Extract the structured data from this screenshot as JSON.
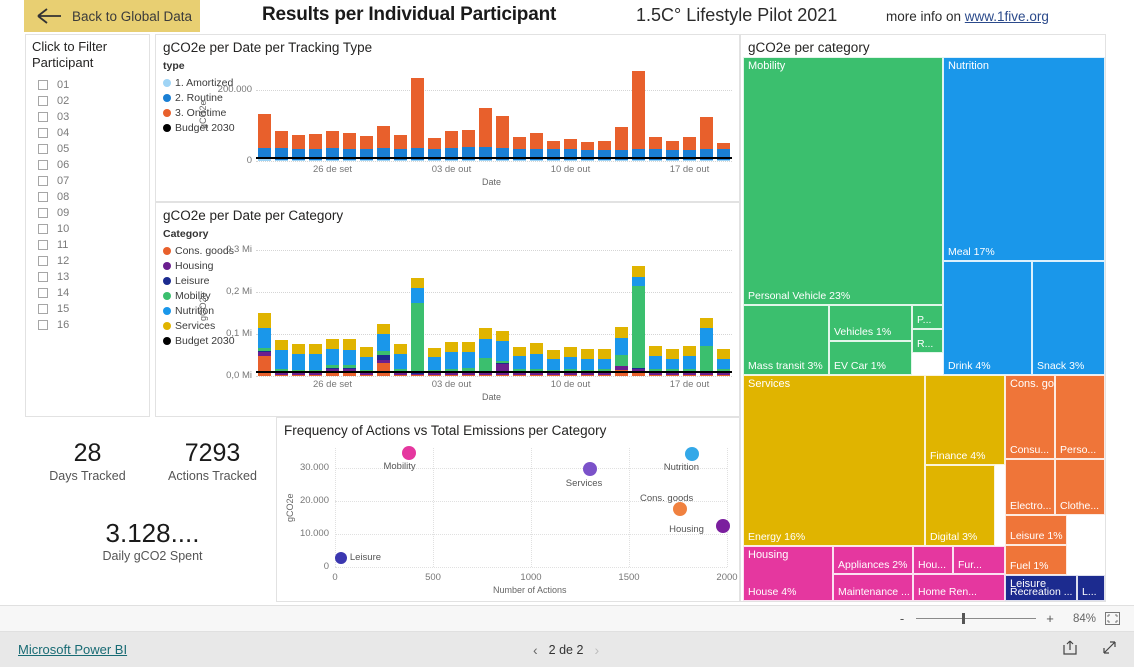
{
  "header": {
    "back_label": "Back to Global Data",
    "back_icon": "arrow-left-icon",
    "title": "Results per Individual Participant",
    "subtitle": "1.5C° Lifestyle Pilot 2021",
    "more_info_prefix": "more info on ",
    "more_info_link": "www.1five.org"
  },
  "slicer": {
    "heading": "Click to Filter Participant",
    "items": [
      "01",
      "02",
      "03",
      "04",
      "05",
      "06",
      "07",
      "08",
      "09",
      "10",
      "11",
      "12",
      "13",
      "14",
      "15",
      "16"
    ]
  },
  "kpis": [
    {
      "value": "28",
      "label": "Days Tracked"
    },
    {
      "value": "7293",
      "label": "Actions Tracked"
    },
    {
      "value": "3.128....",
      "label": "Daily gCO2 Spent"
    }
  ],
  "colors": {
    "amortized": "#9fd4f5",
    "routine": "#1a7fd4",
    "onetime": "#e8602c",
    "budget": "#000000",
    "cons_goods": "#e8602c",
    "housing": "#6b1f8f",
    "leisure": "#1c2b8f",
    "mobility": "#3bbf6e",
    "nutrition": "#1a97ea",
    "services": "#e0b400",
    "housing_tile": "#e5379f",
    "back_bg": "#e8cf72",
    "link": "#186b74"
  },
  "chart_data": [
    {
      "type": "bar",
      "title": "gCO2e per Date per Tracking Type",
      "legend_title": "type",
      "legend": [
        "1. Amortized",
        "2. Routine",
        "3. Onetime",
        "Budget 2030"
      ],
      "xlabel": "Date",
      "ylabel": "gCO2e",
      "ylim": [
        0,
        260000
      ],
      "yticks": [
        "0",
        "200.000"
      ],
      "xticks": [
        "26 de set",
        "03 de out",
        "10 de out",
        "17 de out"
      ],
      "categories": [
        "22 de set",
        "23 de set",
        "24 de set",
        "25 de set",
        "26 de set",
        "27 de set",
        "28 de set",
        "29 de set",
        "30 de set",
        "01 de out",
        "02 de out",
        "03 de out",
        "04 de out",
        "05 de out",
        "06 de out",
        "07 de out",
        "08 de out",
        "09 de out",
        "10 de out",
        "11 de out",
        "12 de out",
        "13 de out",
        "14 de out",
        "15 de out",
        "16 de out",
        "17 de out",
        "18 de out",
        "19 de out"
      ],
      "series": [
        {
          "name": "1. Amortized",
          "values": [
            5000,
            4200,
            4200,
            4200,
            4200,
            4200,
            4200,
            4200,
            4200,
            4200,
            4200,
            4200,
            4200,
            4200,
            4200,
            4200,
            4200,
            4200,
            4200,
            4200,
            4200,
            4200,
            4200,
            4200,
            4200,
            4200,
            4200,
            4200
          ]
        },
        {
          "name": "2. Routine",
          "values": [
            33000,
            32000,
            30000,
            31000,
            32000,
            31000,
            31000,
            32000,
            31000,
            33000,
            31000,
            34000,
            35000,
            36000,
            34000,
            31000,
            30000,
            29000,
            30000,
            26000,
            26000,
            28000,
            29000,
            29000,
            26000,
            28000,
            31000,
            29000
          ]
        },
        {
          "name": "3. Onetime",
          "values": [
            96000,
            48000,
            39000,
            40000,
            48000,
            44000,
            35000,
            62000,
            38000,
            198000,
            29000,
            48000,
            49000,
            110000,
            88000,
            32000,
            44000,
            23000,
            29000,
            23000,
            25000,
            63000,
            222000,
            36000,
            25000,
            36000,
            90000,
            19000
          ]
        }
      ],
      "budget_2030": 12000
    },
    {
      "type": "bar",
      "title": "gCO2e per Date per Category",
      "legend_title": "Category",
      "legend": [
        "Cons. goods",
        "Housing",
        "Leisure",
        "Mobility",
        "Nutrition",
        "Services",
        "Budget 2030"
      ],
      "xlabel": "Date",
      "ylabel": "gCO2e",
      "ylim": [
        0,
        330000
      ],
      "yticks": [
        "0,0 Mi",
        "0,1 Mi",
        "0,2 Mi",
        "0,3 Mi"
      ],
      "xticks": [
        "26 de set",
        "03 de out",
        "10 de out",
        "17 de out"
      ],
      "categories": [
        "22 de set",
        "23 de set",
        "24 de set",
        "25 de set",
        "26 de set",
        "27 de set",
        "28 de set",
        "29 de set",
        "30 de set",
        "01 de out",
        "02 de out",
        "03 de out",
        "04 de out",
        "05 de out",
        "06 de out",
        "07 de out",
        "08 de out",
        "09 de out",
        "10 de out",
        "11 de out",
        "12 de out",
        "13 de out",
        "14 de out",
        "15 de out",
        "16 de out",
        "17 de out",
        "18 de out",
        "19 de out"
      ],
      "series": [
        {
          "name": "Cons. goods",
          "values": [
            48000,
            3000,
            2500,
            2500,
            9000,
            8000,
            2500,
            30000,
            3000,
            3000,
            2500,
            3000,
            3000,
            3000,
            3000,
            2500,
            2500,
            2500,
            2500,
            2500,
            2500,
            14000,
            10000,
            2500,
            2500,
            2500,
            3000,
            2500
          ]
        },
        {
          "name": "Housing",
          "values": [
            9000,
            8000,
            7000,
            7000,
            8000,
            9000,
            7000,
            8000,
            8000,
            3000,
            7000,
            8000,
            8000,
            8000,
            26000,
            7000,
            8000,
            7000,
            7000,
            7000,
            7000,
            9000,
            7000,
            8000,
            8000,
            8000,
            8000,
            5000
          ]
        },
        {
          "name": "Leisure",
          "values": [
            1500,
            1000,
            1000,
            1000,
            1000,
            1000,
            1000,
            12000,
            1000,
            1000,
            1000,
            1000,
            1000,
            1000,
            1000,
            1000,
            1000,
            1000,
            1000,
            1000,
            1000,
            1000,
            1000,
            1000,
            1000,
            1000,
            1000,
            5000
          ]
        },
        {
          "name": "Mobility",
          "values": [
            9000,
            5000,
            5000,
            5000,
            9000,
            9000,
            5000,
            9000,
            5000,
            167000,
            5000,
            5000,
            6000,
            30000,
            6000,
            6000,
            6000,
            5000,
            6000,
            5000,
            6000,
            25000,
            196000,
            6000,
            6000,
            6000,
            60000,
            5000
          ]
        },
        {
          "name": "Nutrition",
          "values": [
            46000,
            44000,
            36000,
            36000,
            38000,
            36000,
            30000,
            40000,
            36000,
            36000,
            30000,
            40000,
            38000,
            45000,
            48000,
            30000,
            34000,
            24000,
            28000,
            24000,
            24000,
            42000,
            20000,
            30000,
            24000,
            30000,
            42000,
            24000
          ]
        },
        {
          "name": "Services",
          "values": [
            36000,
            25000,
            24000,
            24000,
            24000,
            24000,
            24000,
            25000,
            24000,
            24000,
            22000,
            25000,
            26000,
            28000,
            24000,
            22000,
            26000,
            22000,
            24000,
            24000,
            24000,
            26000,
            28000,
            24000,
            22000,
            24000,
            24000,
            22000
          ]
        }
      ],
      "budget_2030": 12000
    },
    {
      "type": "scatter",
      "title": "Frequency of Actions vs Total Emissions per Category",
      "xlabel": "Number of Actions",
      "ylabel": "gCO2e",
      "xlim": [
        0,
        2000
      ],
      "ylim": [
        0,
        36000
      ],
      "xticks": [
        "0",
        "500",
        "1000",
        "1500",
        "2000"
      ],
      "yticks": [
        "0",
        "10.000",
        "20.000",
        "30.000"
      ],
      "points": [
        {
          "label": "Mobility",
          "x": 380,
          "y": 34500,
          "color": "#e5379f",
          "r": 7
        },
        {
          "label": "Nutrition",
          "x": 1820,
          "y": 34300,
          "color": "#33a8e8",
          "r": 7
        },
        {
          "label": "Services",
          "x": 1300,
          "y": 29500,
          "color": "#7b52c9",
          "r": 7
        },
        {
          "label": "Cons. goods",
          "x": 1760,
          "y": 17500,
          "color": "#f0813f",
          "r": 7
        },
        {
          "label": "Housing",
          "x": 1980,
          "y": 12300,
          "color": "#7b1f9e",
          "r": 7
        },
        {
          "label": "Leisure",
          "x": 30,
          "y": 2700,
          "color": "#3b37b0",
          "r": 6
        }
      ]
    }
  ],
  "treemap": {
    "title": "gCO2e per category",
    "groups": [
      {
        "name": "Mobility",
        "color": "#3bbf6e",
        "tiles": [
          {
            "label": "Personal Vehicle 23%"
          },
          {
            "label": "Mass transit 3%"
          },
          {
            "label": "Vehicles 1%"
          },
          {
            "label": "EV Car 1%"
          },
          {
            "label": "P..."
          },
          {
            "label": "R..."
          }
        ]
      },
      {
        "name": "Nutrition",
        "color": "#1a97ea",
        "tiles": [
          {
            "label": "Meal 17%"
          },
          {
            "label": "Drink 4%"
          },
          {
            "label": "Snack 3%"
          }
        ]
      },
      {
        "name": "Services",
        "color": "#e0b400",
        "tiles": [
          {
            "label": "Energy 16%"
          },
          {
            "label": "Finance 4%"
          },
          {
            "label": "Digital 3%"
          }
        ]
      },
      {
        "name": "Cons. goods",
        "color": "#ef7539",
        "tiles": [
          {
            "label": "Consu..."
          },
          {
            "label": "Perso..."
          },
          {
            "label": "Electro..."
          },
          {
            "label": "Clothe..."
          },
          {
            "label": "Leisure 1%"
          },
          {
            "label": "Fuel 1%"
          }
        ]
      },
      {
        "name": "Housing",
        "color": "#e5379f",
        "tiles": [
          {
            "label": "House 4%"
          },
          {
            "label": "Appliances 2%"
          },
          {
            "label": "Maintenance ..."
          },
          {
            "label": "Hou..."
          },
          {
            "label": "Fur..."
          },
          {
            "label": "Home Ren..."
          }
        ]
      },
      {
        "name": "Leisure",
        "color": "#1c2b8f",
        "tiles": [
          {
            "label": "Recreation ..."
          },
          {
            "label": "L..."
          }
        ]
      }
    ]
  },
  "zoombar": {
    "minus": "-",
    "plus": "+",
    "percent": "84%",
    "fit_icon": "fit-to-page-icon"
  },
  "footer": {
    "brand": "Microsoft Power BI",
    "page_text": "2 de 2",
    "prev_icon": "chevron-left-icon",
    "next_icon": "chevron-right-icon",
    "share_icon": "share-icon",
    "fullscreen_icon": "fullscreen-icon"
  }
}
